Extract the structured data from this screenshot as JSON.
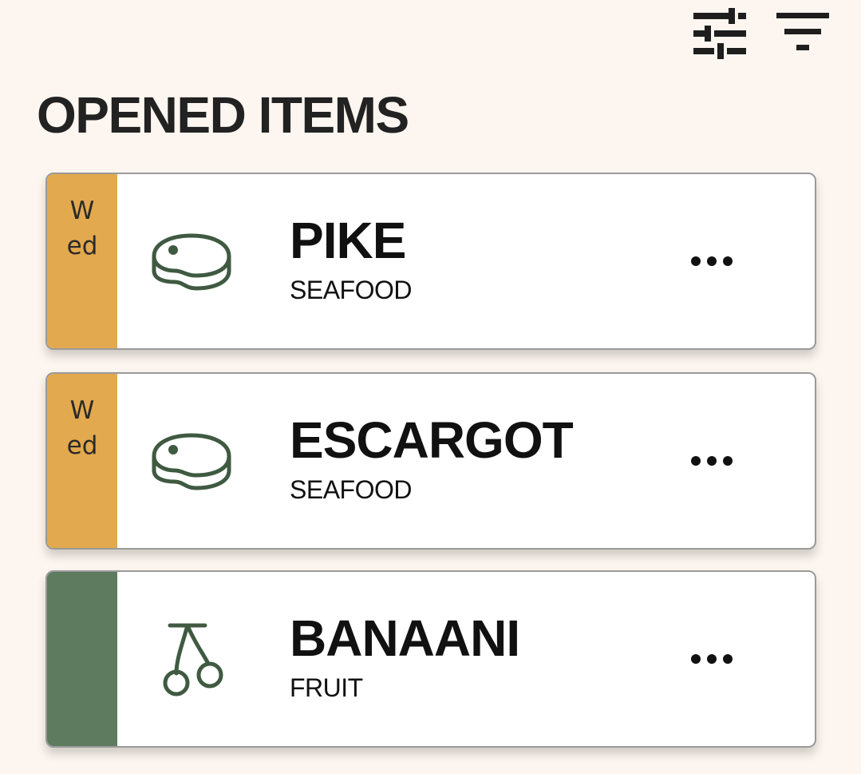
{
  "toolbar": {
    "adjust_icon": "sliders-icon",
    "filter_icon": "filter-icon"
  },
  "title": "OPENED ITEMS",
  "colors": {
    "background": "#fdf6f0",
    "strip_yellow": "#e3a94e",
    "strip_green": "#5e7a5f",
    "icon_green": "#3f5a41"
  },
  "items": [
    {
      "day": "Wed",
      "strip_color": "#e3a94e",
      "icon": "meat-icon",
      "name": "PIKE",
      "category": "SEAFOOD",
      "more_icon": "more-icon"
    },
    {
      "day": "Wed",
      "strip_color": "#e3a94e",
      "icon": "meat-icon",
      "name": "ESCARGOT",
      "category": "SEAFOOD",
      "more_icon": "more-icon"
    },
    {
      "day": "",
      "strip_color": "#5e7a5f",
      "icon": "cherry-icon",
      "name": "BANAANI",
      "category": "FRUIT",
      "more_icon": "more-icon"
    }
  ]
}
